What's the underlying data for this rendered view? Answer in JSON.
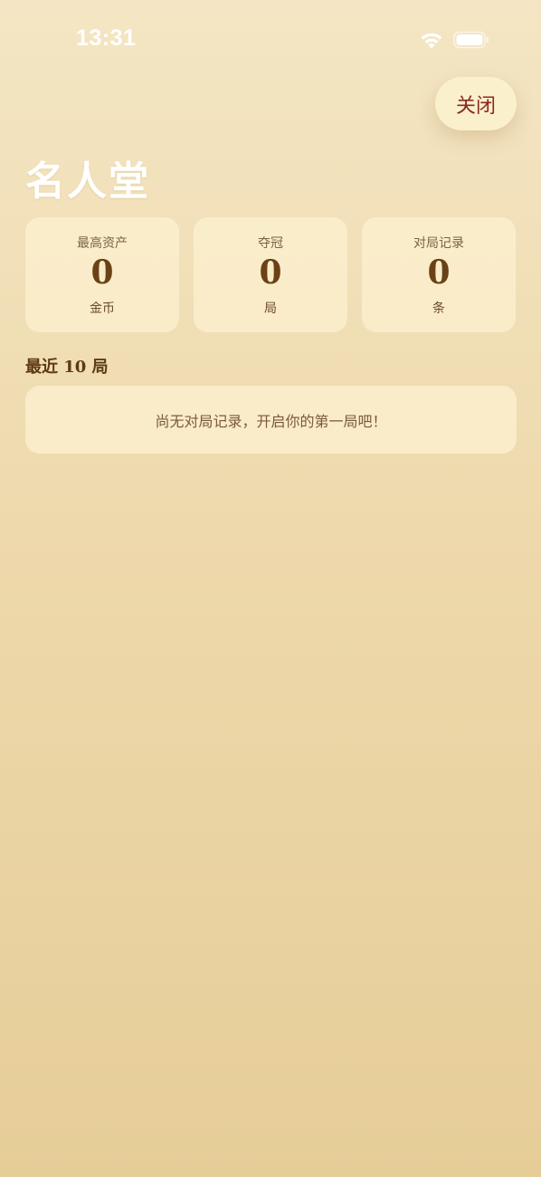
{
  "status_bar": {
    "time": "13:31",
    "icons": [
      "wifi-icon",
      "battery-icon"
    ]
  },
  "header": {
    "close_label": "关闭",
    "title": "名人堂"
  },
  "stats": [
    {
      "label": "最高资产",
      "value": "0",
      "unit": "金币"
    },
    {
      "label": "夺冠",
      "value": "0",
      "unit": "局"
    },
    {
      "label": "对局记录",
      "value": "0",
      "unit": "条"
    }
  ],
  "recent": {
    "heading": "最近 10 局",
    "empty_text": "尚无对局记录，开启你的第一局吧！"
  },
  "colors": {
    "background_top": "#f4e6c4",
    "background_bottom": "#e6cd98",
    "card": "#fbeecc",
    "accent_text": "#8a2a1e",
    "value_text": "#6a4216"
  }
}
